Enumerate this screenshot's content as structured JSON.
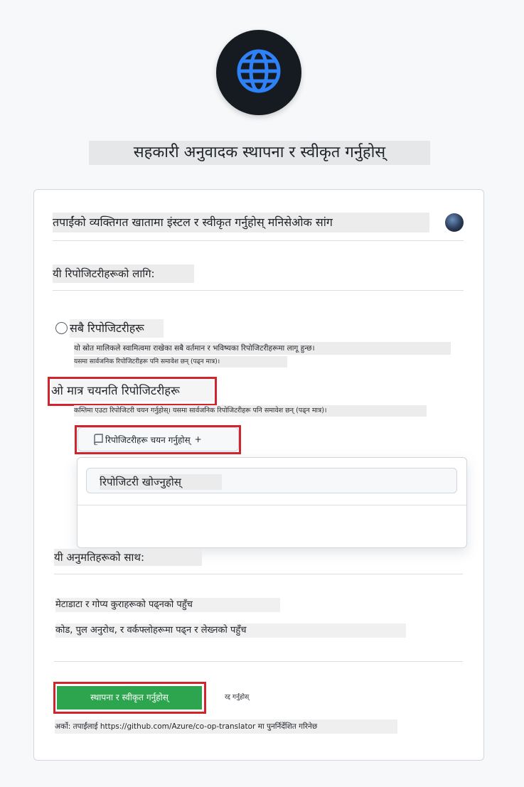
{
  "header": {
    "logo_icon": "globe-icon",
    "title": "सहकारी अनुवादक स्थापना र स्वीकृत गर्नुहोस्"
  },
  "account": {
    "label": "तपाईंको व्यक्तिगत खातामा इंस्टल र स्वीकृत गर्नुहोस् मनिसेओक सांग"
  },
  "repositories": {
    "heading": "यी रिपोजिटरीहरूको लागि:",
    "all_option": {
      "label": "सबै रिपोजिटरीहरू",
      "description": "यो स्रोत मालिकले स्वामित्वमा राखेका सबै वर्तमान र भविष्यका रिपोजिटरीहरूमा लागू हुन्छ।",
      "note": "यसमा सार्वजनिक रिपोजिटरीहरू पनि समावेश छन् (पढ्न मात्र)।"
    },
    "selected_option": {
      "label": "ओ मात्र चयनति रिपोजिटरीहरू",
      "description": "कम्तिमा एउटा रिपोजिटरी चयन गर्नुहोस्। यसमा सार्वजनिक रिपोजिटरीहरू पनि समावेश छन् (पढ्न मात्र)।"
    },
    "select_button": "रिपोजिटरीहरू चयन गर्नुहोस्",
    "select_button_suffix": "+",
    "search_placeholder": "रिपोजिटरी खोज्नुहोस्"
  },
  "permissions": {
    "heading": "यी अनुमतिहरूको साथ:",
    "items": [
      "मेटाडाटा र गोप्य कुराहरूको पढ्नको पहुँच",
      "कोड, पुल अनुरोध, र वर्कफ्लोहरूमा पढ्न र लेख्नको पहुँच"
    ]
  },
  "actions": {
    "install": "स्थापना र स्वीकृत गर्नुहोस्",
    "cancel": "रद्द गर्नुहोस्"
  },
  "footer": {
    "redirect_note": "अर्को: तपाईंलाई https://github.com/Azure/co-op-translator मा पुनर्निर्देशित गरिनेछ"
  },
  "colors": {
    "accent_green": "#2da44e",
    "highlight_red": "#d1242f",
    "globe_blue": "#2f81f7"
  }
}
